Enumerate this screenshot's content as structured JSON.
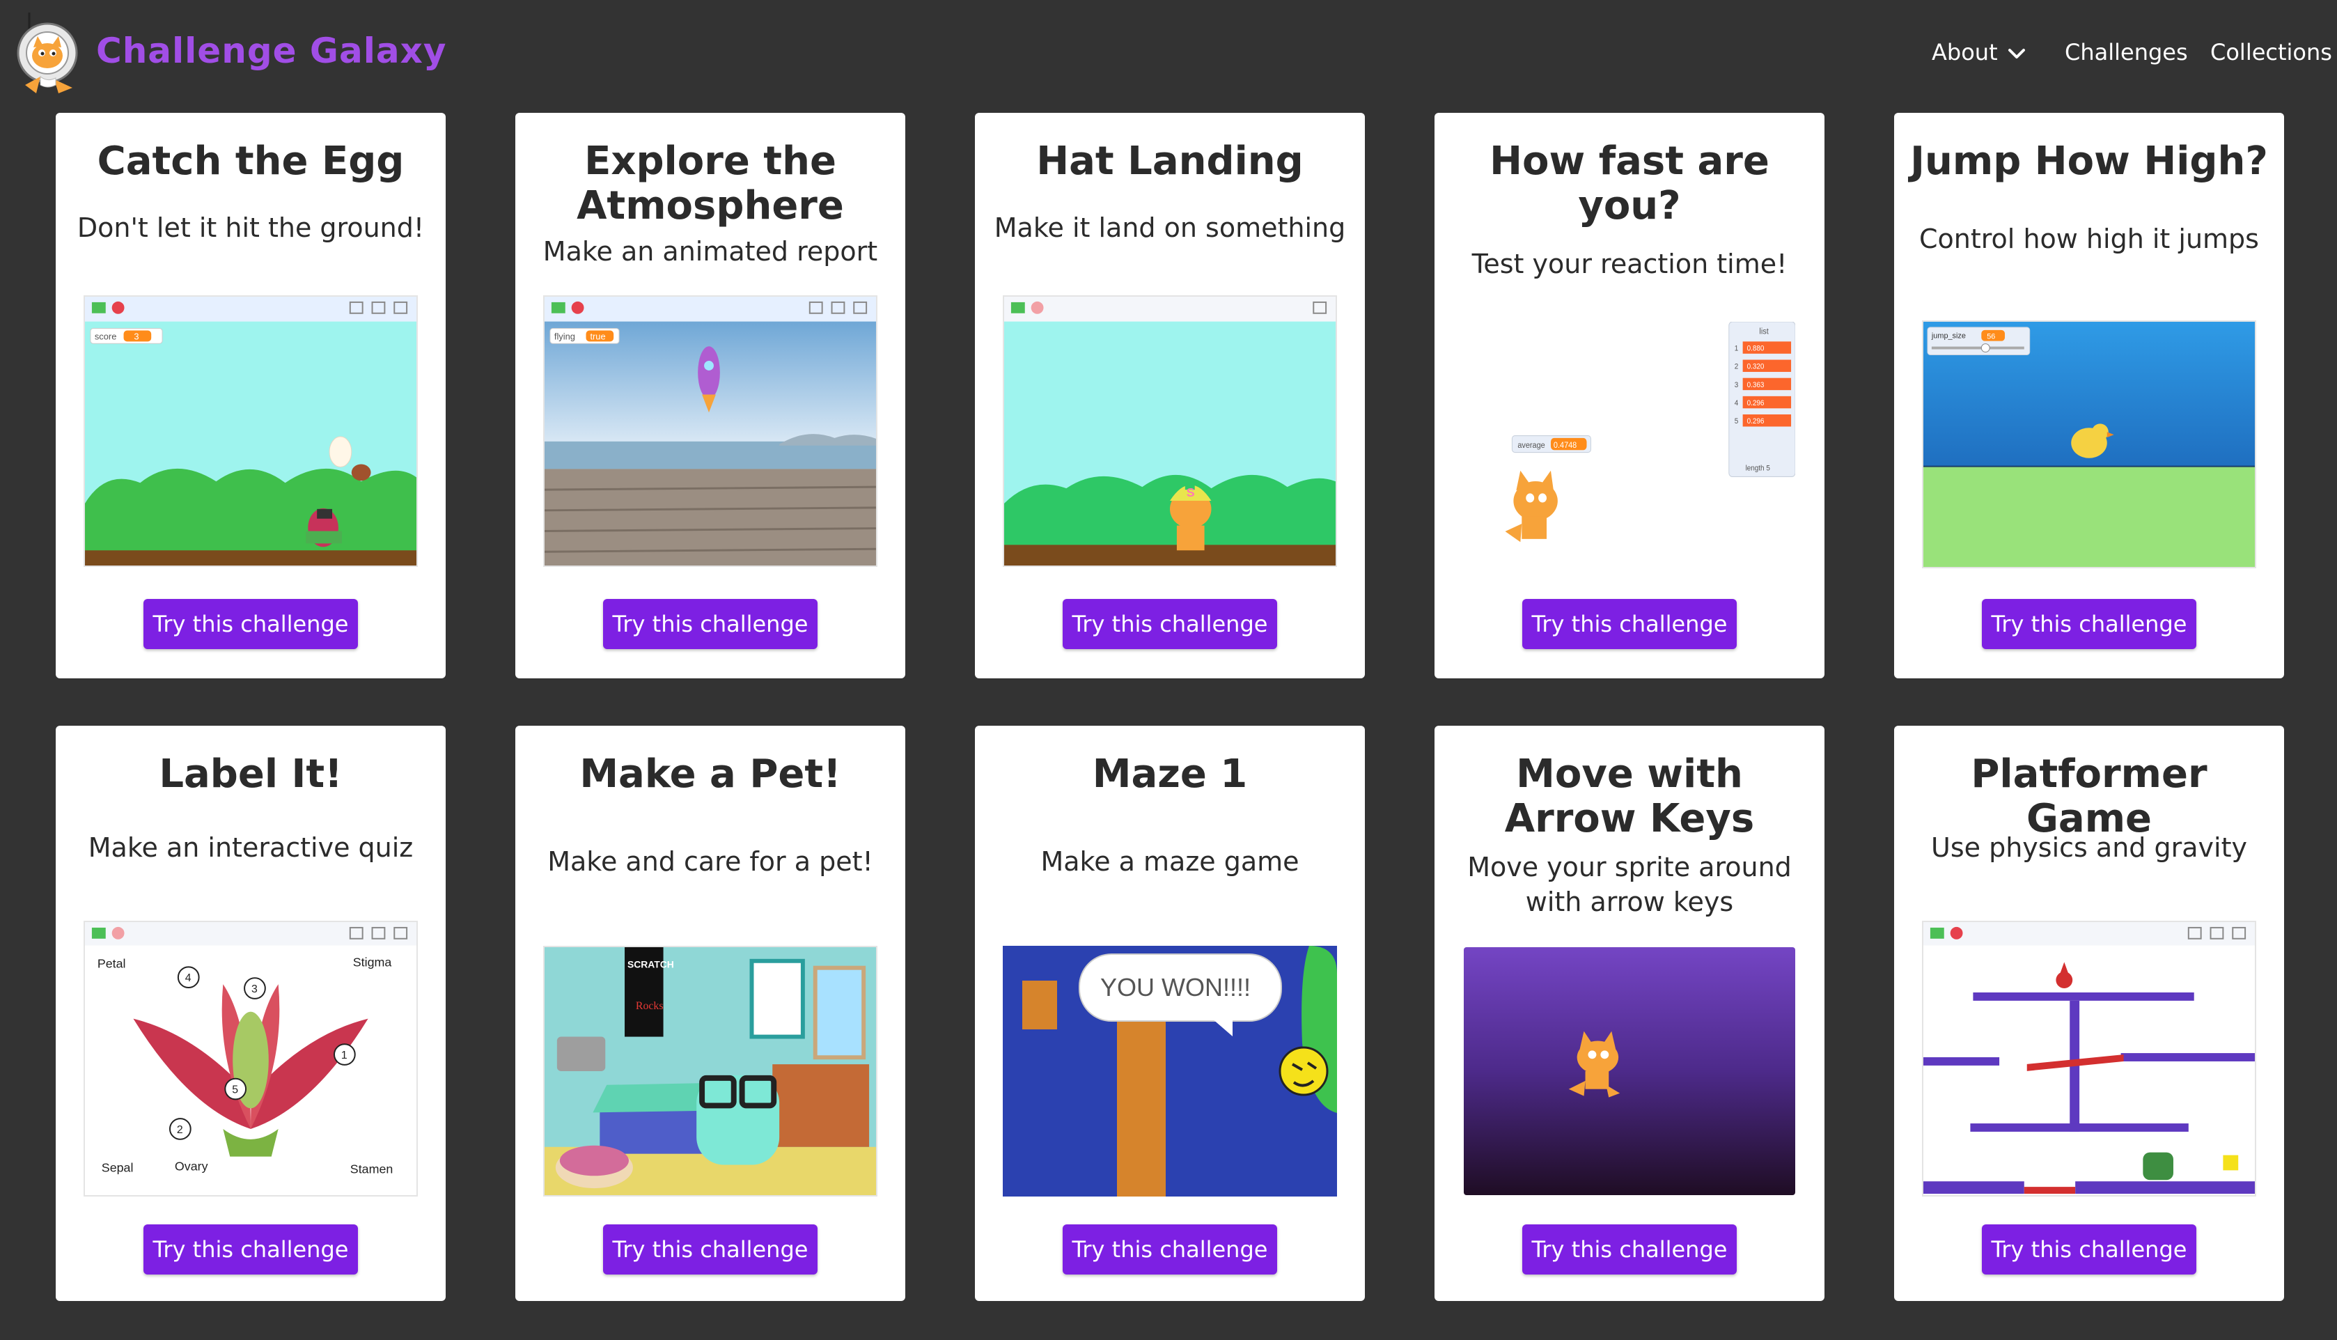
{
  "header": {
    "brand": "Challenge Galaxy",
    "nav": {
      "about": "About",
      "challenges": "Challenges",
      "collections": "Collections"
    }
  },
  "colors": {
    "background": "#333333",
    "brand": "#a14ee6",
    "button": "#7d20e3",
    "card": "#ffffff"
  },
  "cta_label": "Try this challenge",
  "cards": [
    {
      "title": "Catch the Egg",
      "subtitle": "Don't let it hit the ground!",
      "thumb_text": {
        "score_label": "score",
        "score_value": "3"
      }
    },
    {
      "title": "Explore the Atmosphere",
      "subtitle": "Make an animated report",
      "thumb_text": {
        "var_label": "flying",
        "var_value": "true"
      }
    },
    {
      "title": "Hat Landing",
      "subtitle": "Make it land on something",
      "thumb_text": {
        "hat_letter": "S"
      }
    },
    {
      "title": "How fast are you?",
      "subtitle": "Test your reaction time!",
      "thumb_text": {
        "avg_label": "average",
        "avg_value": "0.4748",
        "list_title": "list",
        "list_values": [
          "0.880",
          "0.320",
          "0.363",
          "0.296",
          "0.296"
        ],
        "list_length": "length 5"
      }
    },
    {
      "title": "Jump How High?",
      "subtitle": "Control how high it jumps",
      "thumb_text": {
        "slider_label": "jump_size",
        "slider_value": "56"
      }
    },
    {
      "title": "Label It!",
      "subtitle": "Make an interactive quiz",
      "thumb_text": {
        "petal": "Petal",
        "stigma": "Stigma",
        "sepal": "Sepal",
        "ovary": "Ovary",
        "stamen": "Stamen"
      }
    },
    {
      "title": "Make a Pet!",
      "subtitle": "Make and care for a pet!",
      "thumb_text": {
        "poster_top": "SCRATCH",
        "poster_bottom": "Rocks"
      }
    },
    {
      "title": "Maze 1",
      "subtitle": "Make a maze game",
      "thumb_text": {
        "bubble": "YOU WON!!!!"
      }
    },
    {
      "title": "Move with Arrow Keys",
      "subtitle": "Move your sprite around with arrow keys",
      "thumb_text": {}
    },
    {
      "title": "Platformer Game",
      "subtitle": "Use physics and gravity",
      "thumb_text": {}
    }
  ]
}
